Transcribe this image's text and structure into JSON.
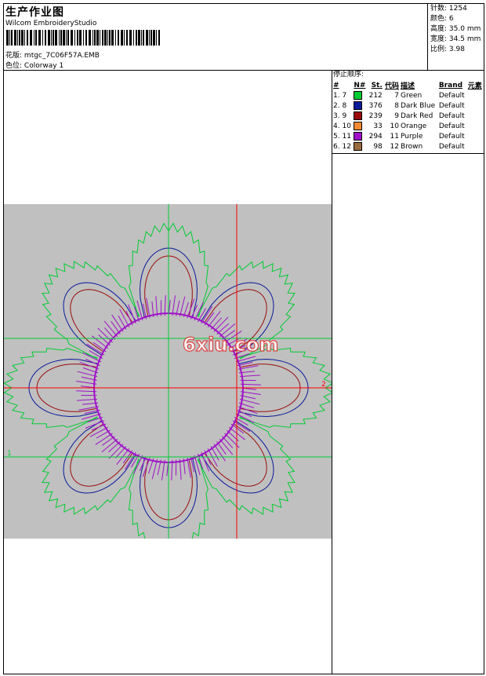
{
  "header": {
    "title": "生产作业图",
    "subtitle": "Wilcom EmbroideryStudio",
    "design_label": "花版:",
    "design_file": "mtgc_7C06F57A.EMB",
    "colorway_label": "色位:",
    "colorway": "Colorway 1"
  },
  "stats": [
    {
      "label": "针数:",
      "value": "1254"
    },
    {
      "label": "颜色:",
      "value": "6"
    },
    {
      "label": "高度:",
      "value": "35.0 mm"
    },
    {
      "label": "宽度:",
      "value": "34.5 mm"
    },
    {
      "label": "比例:",
      "value": "3.98"
    }
  ],
  "stop_sequence": {
    "title": "停止顺序:",
    "columns": [
      "#",
      "N#",
      "St.",
      "代码",
      "描述",
      "Brand",
      "元素"
    ],
    "rows": [
      {
        "idx": "1.",
        "n": "7",
        "color": "#00cc33",
        "st": "212",
        "code": "7",
        "desc": "Green",
        "brand": "Default"
      },
      {
        "idx": "2.",
        "n": "8",
        "color": "#0a1a99",
        "st": "376",
        "code": "8",
        "desc": "Dark Blue",
        "brand": "Default"
      },
      {
        "idx": "3.",
        "n": "9",
        "color": "#9a0a0a",
        "st": "239",
        "code": "9",
        "desc": "Dark Red",
        "brand": "Default"
      },
      {
        "idx": "4.",
        "n": "10",
        "color": "#f28a33",
        "st": "33",
        "code": "10",
        "desc": "Orange",
        "brand": "Default"
      },
      {
        "idx": "5.",
        "n": "11",
        "color": "#a010c8",
        "st": "294",
        "code": "11",
        "desc": "Purple",
        "brand": "Default"
      },
      {
        "idx": "6.",
        "n": "12",
        "color": "#9a6a40",
        "st": "98",
        "code": "12",
        "desc": "Brown",
        "brand": "Default"
      }
    ]
  },
  "preview": {
    "background": "#c0c0c0",
    "watermark": "6xiu.com",
    "marker_start": "1",
    "marker_end": "2",
    "petal_count": 8,
    "colors": {
      "green": "#00cc33",
      "blue": "#0a1a99",
      "red": "#9a0a0a",
      "purple": "#a010c8",
      "axis": "#ff0000",
      "crosshair": "#00cc33"
    }
  }
}
